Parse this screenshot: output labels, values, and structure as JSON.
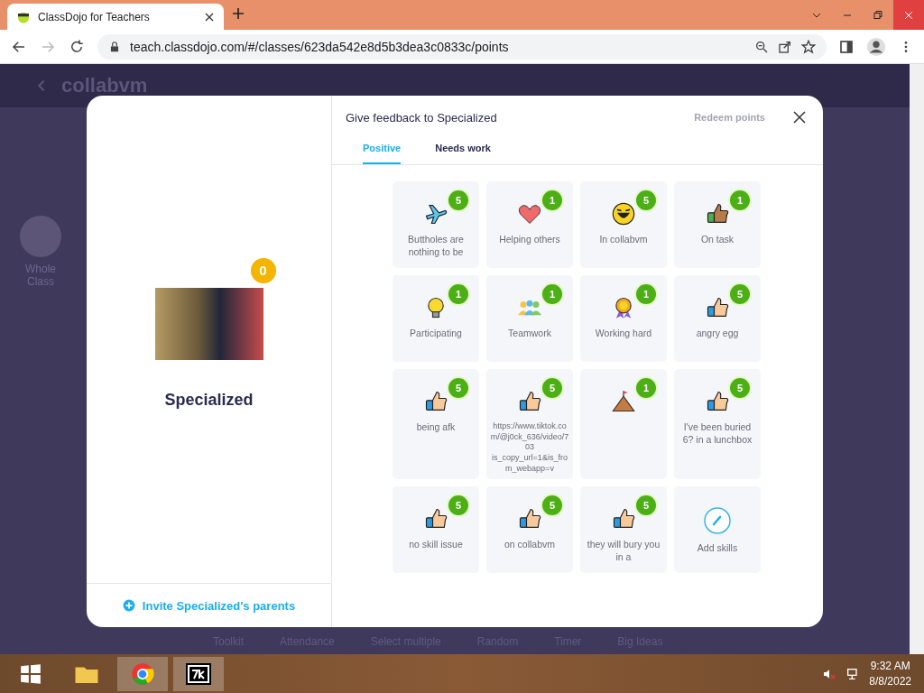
{
  "browser": {
    "tab_title": "ClassDojo for Teachers",
    "url": "teach.classdojo.com/#/classes/623da542e8d5b3dea3c0833c/points"
  },
  "page": {
    "class_name": "collabvm",
    "sidebar": [
      "Whole Class"
    ],
    "toolbar": [
      "Toolkit",
      "Attendance",
      "Select multiple",
      "Random",
      "Timer",
      "Big Ideas"
    ]
  },
  "modal": {
    "student": {
      "name": "Specialized",
      "points": "0"
    },
    "invite_link": "Invite Specialized's parents",
    "title": "Give feedback to Specialized",
    "redeem_button": {
      "label": "Redeem points",
      "disabled": true
    },
    "tabs": [
      {
        "label": "Positive",
        "selected": true
      },
      {
        "label": "Needs work",
        "selected": false
      }
    ],
    "skills": [
      {
        "kind": "airplane",
        "label": "Buttholes are nothing to be",
        "points": "5"
      },
      {
        "kind": "heart",
        "label": "Helping others",
        "points": "1"
      },
      {
        "kind": "laugh",
        "label": "In collabvm",
        "points": "5"
      },
      {
        "kind": "thumbdark",
        "label": "On task",
        "points": "1"
      },
      {
        "kind": "bulb",
        "label": "Participating",
        "points": "1"
      },
      {
        "kind": "team",
        "label": "Teamwork",
        "points": "1"
      },
      {
        "kind": "medal",
        "label": "Working hard",
        "points": "1"
      },
      {
        "kind": "thumb",
        "label": "angry egg",
        "points": "5"
      },
      {
        "kind": "thumb",
        "label": "being afk",
        "points": "5"
      },
      {
        "kind": "thumb",
        "label": "https://www.tiktok.com/@j0ck_636/video/703 is_copy_url=1&is_from_webapp=v",
        "points": "5"
      },
      {
        "kind": "mountain",
        "points": "1"
      },
      {
        "kind": "thumb",
        "label": "I've been buried 6? in a lunchbox",
        "points": "5"
      },
      {
        "kind": "thumb",
        "label": "no skill issue",
        "points": "5"
      },
      {
        "kind": "thumb",
        "label": "on collabvm",
        "points": "5"
      },
      {
        "kind": "thumb",
        "label": "they will bury you in a",
        "points": "5"
      },
      {
        "kind": "add",
        "label": "Add skills"
      }
    ]
  },
  "taskbar": {
    "time": "9:32 AM",
    "date": "8/8/2022"
  }
}
